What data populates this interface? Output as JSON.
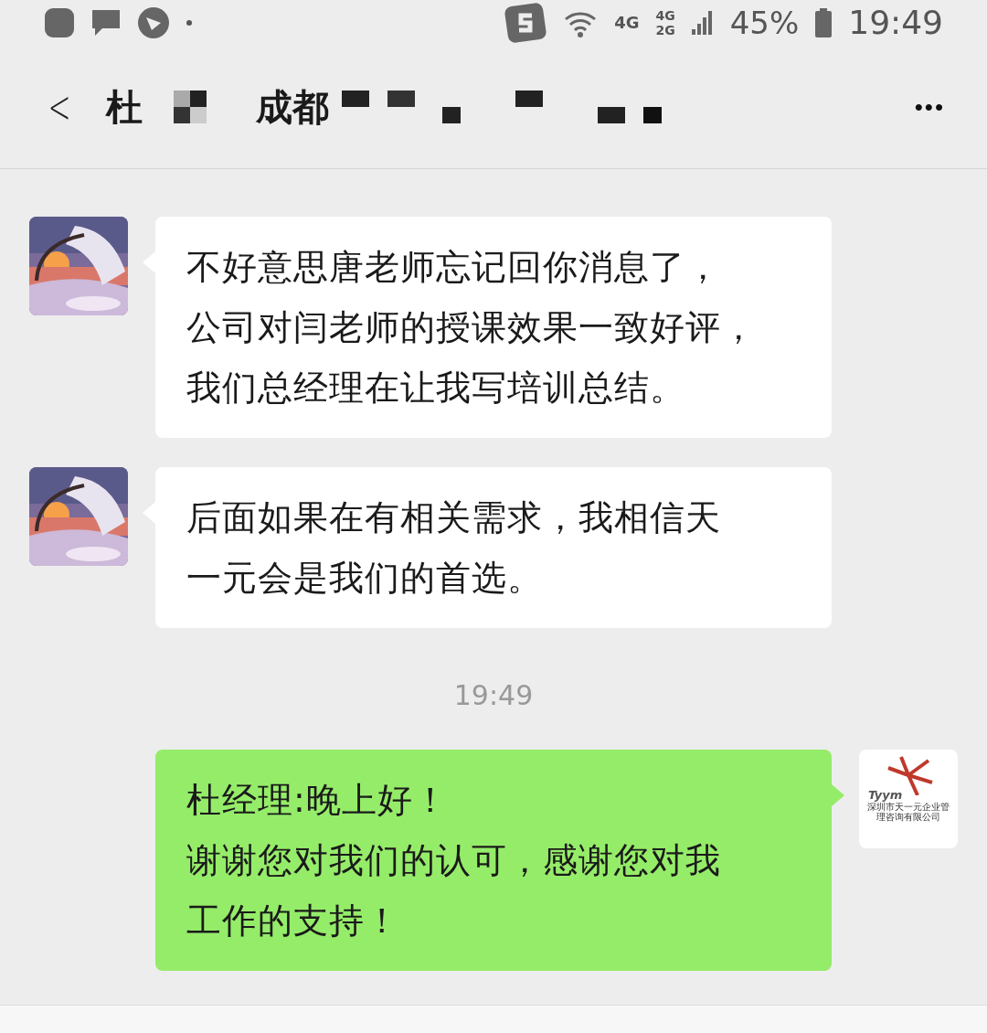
{
  "status_bar": {
    "network_top": "4G",
    "network_sim1": "4G",
    "network_sim2": "2G",
    "battery": "45%",
    "time": "19:49"
  },
  "header": {
    "back": "<",
    "title_parts": [
      "杜",
      "成都"
    ],
    "more": "•••"
  },
  "messages": [
    {
      "kind": "received",
      "lines": [
        "不好意思唐老师忘记回你消息了，",
        "公司对闫老师的授课效果一致好评，",
        "我们总经理在让我写培训总结。"
      ]
    },
    {
      "kind": "received",
      "lines": [
        "后面如果在有相关需求，我相信天",
        "一元会是我们的首选。"
      ]
    },
    {
      "kind": "time",
      "text": "19:49"
    },
    {
      "kind": "sent",
      "lines": [
        "杜经理:晚上好！",
        "谢谢您对我们的认可，感谢您对我",
        "工作的支持！"
      ],
      "avatar": {
        "brand": "Tyym",
        "caption": "深圳市天一元企业管理咨询有限公司"
      }
    }
  ]
}
